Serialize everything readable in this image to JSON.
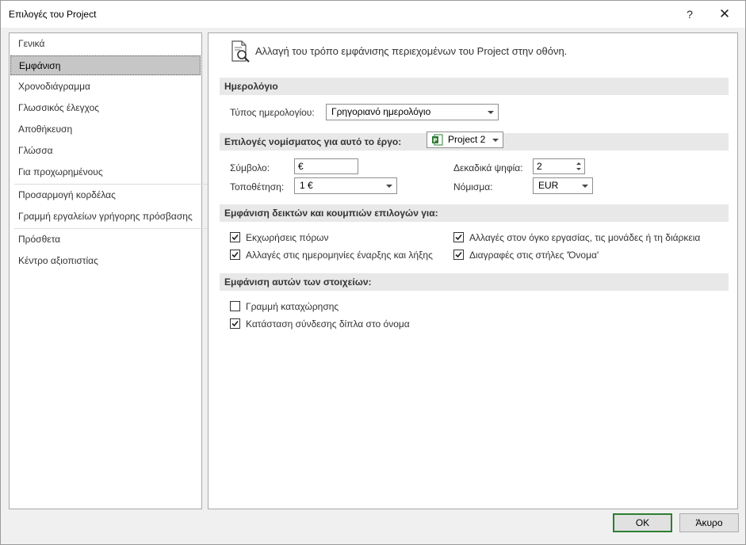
{
  "window": {
    "title": "Επιλογές του Project",
    "help_label": "?",
    "close_label": "✕"
  },
  "nav": {
    "items": [
      {
        "label": "Γενικά"
      },
      {
        "label": "Εμφάνιση",
        "selected": true
      },
      {
        "label": "Χρονοδιάγραμμα"
      },
      {
        "label": "Γλωσσικός έλεγχος"
      },
      {
        "label": "Αποθήκευση"
      },
      {
        "label": "Γλώσσα"
      },
      {
        "label": "Για προχωρημένους"
      },
      {
        "label": "Προσαρμογή κορδέλας"
      },
      {
        "label": "Γραμμή εργαλείων γρήγορης πρόσβασης"
      },
      {
        "label": "Πρόσθετα"
      },
      {
        "label": "Κέντρο αξιοπιστίας"
      }
    ]
  },
  "header": {
    "icon": "page-magnifier-icon",
    "text": "Αλλαγή του τρόπο εμφάνισης περιεχομένων του Project στην οθόνη."
  },
  "calendar": {
    "section_title": "Ημερολόγιο",
    "type_label": "Τύπος ημερολογίου:",
    "type_value": "Γρηγοριανό ημερολόγιο"
  },
  "currency": {
    "section_title": "Επιλογές νομίσματος για αυτό το έργο:",
    "project_value": "Project 2",
    "symbol_label": "Σύμβολο:",
    "symbol_value": "€",
    "placement_label": "Τοποθέτηση:",
    "placement_value": "1 €",
    "decimals_label": "Δεκαδικά ψηφία:",
    "decimals_value": "2",
    "currency_label": "Νόμισμα:",
    "currency_value": "EUR"
  },
  "indicators": {
    "section_title": "Εμφάνιση δεικτών και κουμπιών επιλογών για:",
    "options": [
      {
        "label": "Εκχωρήσεις πόρων",
        "checked": true
      },
      {
        "label": "Αλλαγές στις ημερομηνίες έναρξης και λήξης",
        "checked": true
      },
      {
        "label": "Αλλαγές στον όγκο εργασίας, τις μονάδες ή τη διάρκεια",
        "checked": true
      },
      {
        "label": "Διαγραφές στις στήλες 'Όνομα'",
        "checked": true
      }
    ]
  },
  "elements": {
    "section_title": "Εμφάνιση αυτών των στοιχείων:",
    "options": [
      {
        "label": "Γραμμή καταχώρησης",
        "checked": false
      },
      {
        "label": "Κατάσταση σύνδεσης δίπλα στο όνομα",
        "checked": true
      }
    ]
  },
  "footer": {
    "ok_label": "OK",
    "cancel_label": "Άκυρο"
  },
  "colors": {
    "accent_green": "#2e7d32",
    "selected_nav": "#c6c6c6",
    "section_bg": "#e8e8e8"
  }
}
